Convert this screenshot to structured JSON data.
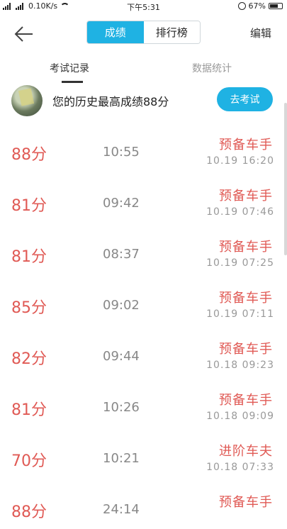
{
  "status": {
    "network_speed": "0.10K/s",
    "time": "下午5:31",
    "battery": "67%"
  },
  "header": {
    "tabs": [
      {
        "label": "成绩",
        "active": true
      },
      {
        "label": "排行榜",
        "active": false
      }
    ],
    "edit_label": "编辑"
  },
  "subtabs": [
    {
      "label": "考试记录",
      "active": true
    },
    {
      "label": "数据统计",
      "active": false
    }
  ],
  "summary": {
    "text": "您的历史最高成绩88分",
    "button": "去考试"
  },
  "records": [
    {
      "score": "88分",
      "duration": "10:55",
      "rank": "预备车手",
      "date": "10.19  16:20"
    },
    {
      "score": "81分",
      "duration": "09:42",
      "rank": "预备车手",
      "date": "10.19  07:46"
    },
    {
      "score": "81分",
      "duration": "08:37",
      "rank": "预备车手",
      "date": "10.19  07:25"
    },
    {
      "score": "85分",
      "duration": "09:02",
      "rank": "预备车手",
      "date": "10.19  07:11"
    },
    {
      "score": "82分",
      "duration": "09:44",
      "rank": "预备车手",
      "date": "10.18  09:23"
    },
    {
      "score": "81分",
      "duration": "10:26",
      "rank": "预备车手",
      "date": "10.18  09:09"
    },
    {
      "score": "70分",
      "duration": "10:21",
      "rank": "进阶车夫",
      "date": "10.18  07:33"
    },
    {
      "score": "88分",
      "duration": "24:14",
      "rank": "预备车手",
      "date": ""
    }
  ],
  "colors": {
    "accent": "#1fb2e3",
    "score": "#e05a55"
  }
}
